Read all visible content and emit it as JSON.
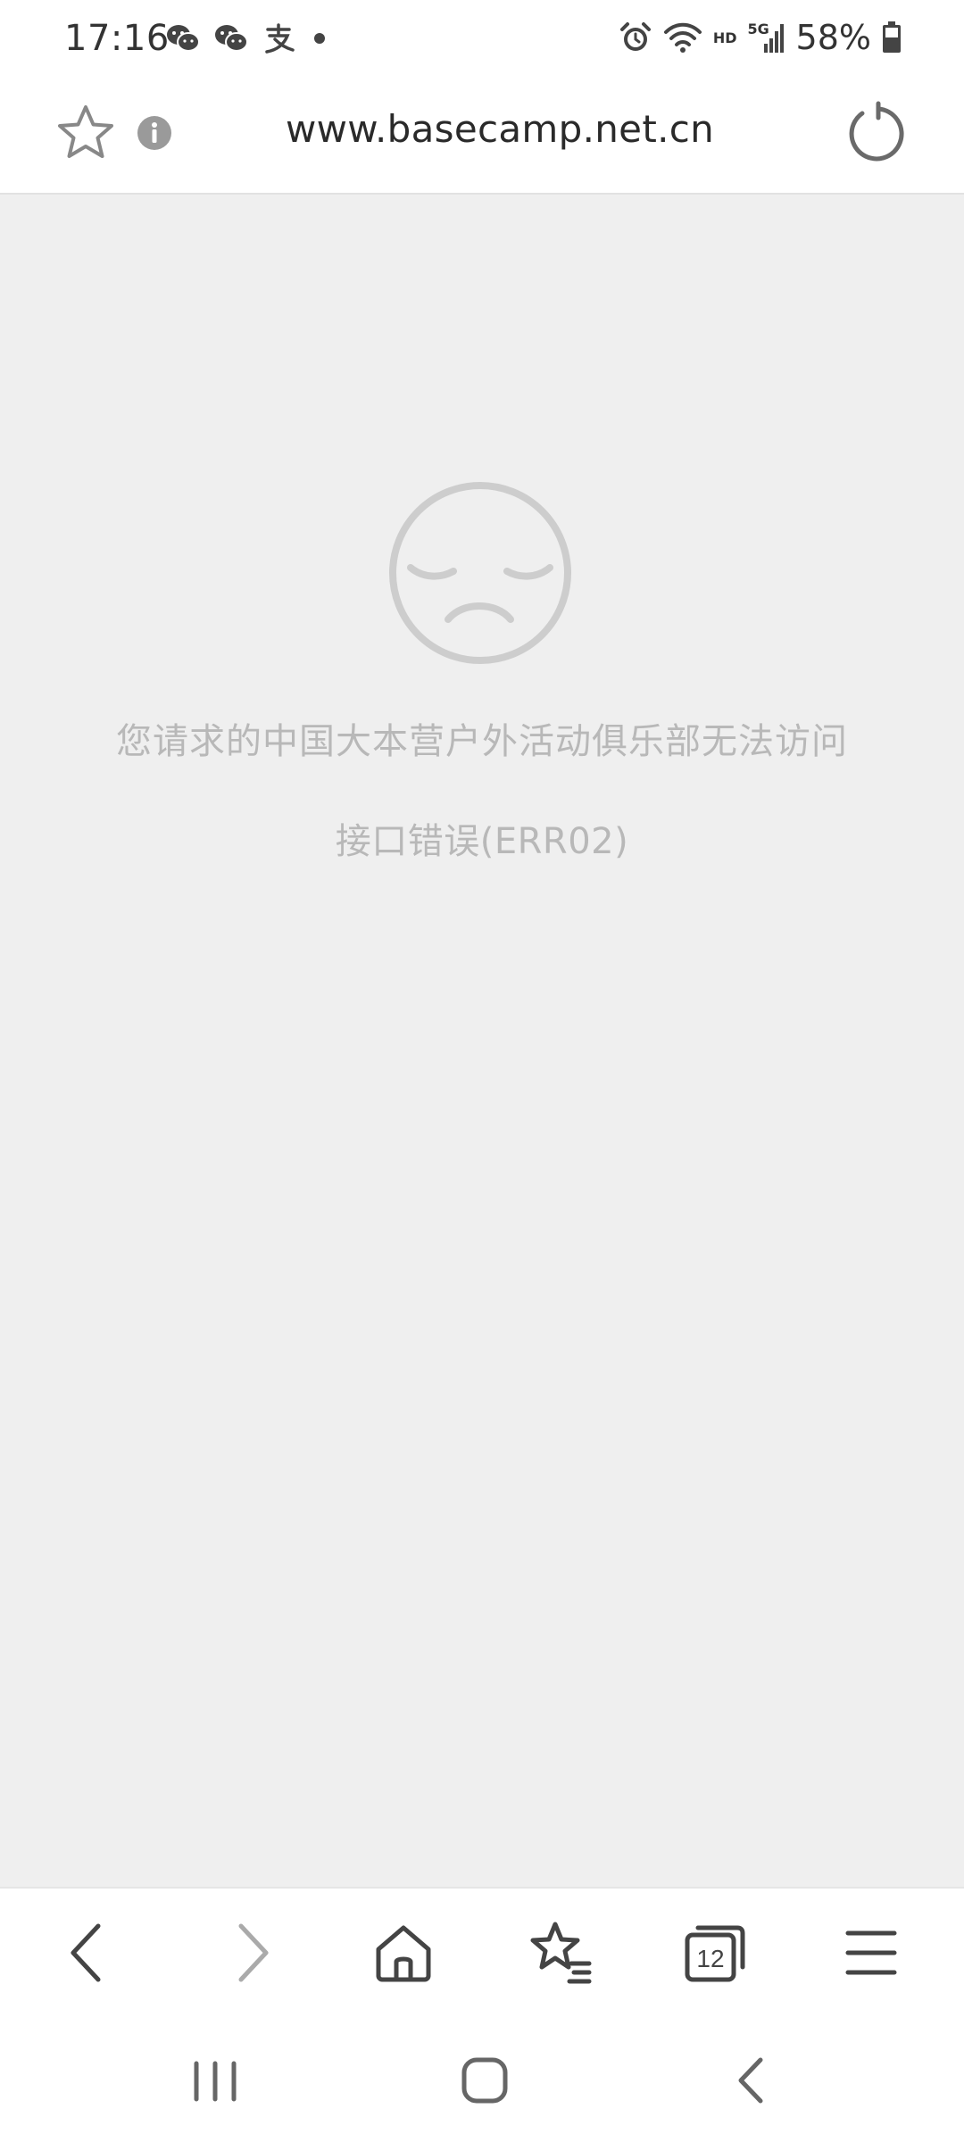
{
  "status_bar": {
    "time": "17:16",
    "notification_icons": [
      "wechat-icon",
      "wechat-icon",
      "alipay-icon",
      "dot-icon"
    ],
    "alarm_icon": "alarm-icon",
    "wifi_icon": "wifi-icon",
    "hd_label": "HD",
    "network_label": "5G",
    "battery_percent": "58%"
  },
  "address_bar": {
    "url": "www.basecamp.net.cn"
  },
  "error_page": {
    "message": "您请求的中国大本营户外活动俱乐部无法访问",
    "detail": "接口错误(ERR02)"
  },
  "toolbar": {
    "tabs_count": "12"
  }
}
